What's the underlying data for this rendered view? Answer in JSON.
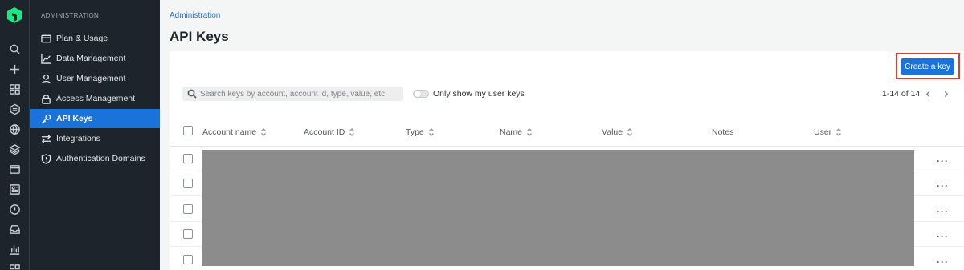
{
  "rail": {
    "icons": [
      "search-icon",
      "plus-icon",
      "apps-grid-icon",
      "logs-icon",
      "globe-icon",
      "layers-icon",
      "browser-icon",
      "dashboard-icon",
      "alert-icon",
      "inbox-icon",
      "chart-icon",
      "grid-icon"
    ]
  },
  "sidebar": {
    "header": "ADMINISTRATION",
    "items": [
      {
        "label": "Plan & Usage",
        "icon": "card-icon"
      },
      {
        "label": "Data Management",
        "icon": "line-chart-icon"
      },
      {
        "label": "User Management",
        "icon": "user-icon"
      },
      {
        "label": "Access Management",
        "icon": "lock-icon"
      },
      {
        "label": "API Keys",
        "icon": "key-icon",
        "active": true
      },
      {
        "label": "Integrations",
        "icon": "arrows-icon"
      },
      {
        "label": "Authentication Domains",
        "icon": "shield-icon"
      }
    ]
  },
  "breadcrumb": "Administration",
  "title": "API Keys",
  "create_button": "Create a key",
  "search": {
    "placeholder": "Search keys by account, account id, type, value, etc.",
    "value": ""
  },
  "toggle": {
    "label": "Only show my user keys",
    "on": false
  },
  "pagination": {
    "text": "1-14 of 14"
  },
  "table": {
    "columns": [
      "Account name",
      "Account ID",
      "Type",
      "Name",
      "Value",
      "Notes",
      "User"
    ],
    "sortable": [
      true,
      true,
      true,
      true,
      true,
      false,
      true
    ],
    "row_menu_label": "···"
  },
  "colors": {
    "accent": "#1a73d9",
    "sidebar_bg": "#1d252c",
    "highlight": "#e13b2e",
    "redaction": "#8c8c8c"
  }
}
